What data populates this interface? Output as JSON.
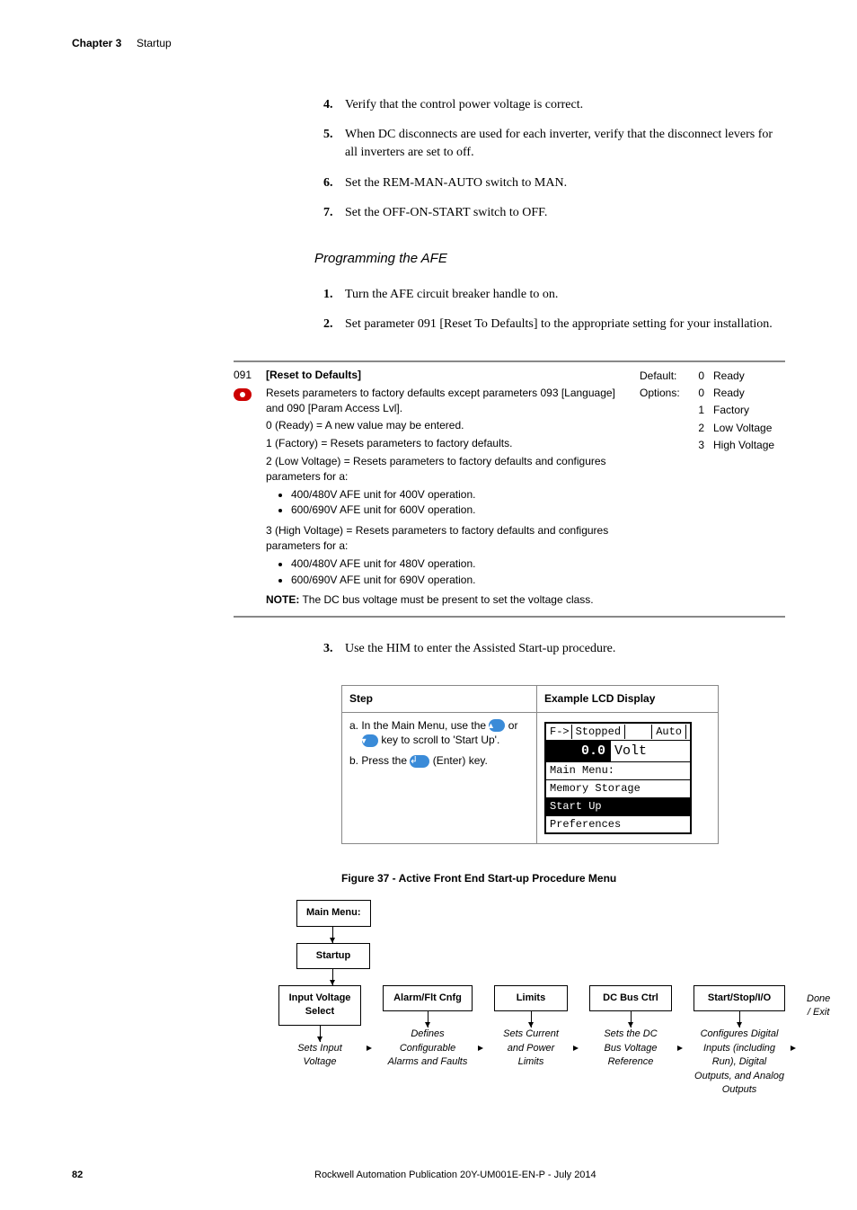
{
  "header": {
    "chapter": "Chapter 3",
    "title": "Startup"
  },
  "steps1": [
    {
      "n": "4.",
      "t": "Verify that the control power voltage is correct."
    },
    {
      "n": "5.",
      "t": "When DC disconnects are used for each inverter, verify that the disconnect levers for all inverters are set to off."
    },
    {
      "n": "6.",
      "t": "Set the REM-MAN-AUTO switch to MAN."
    },
    {
      "n": "7.",
      "t": "Set the OFF-ON-START switch to OFF."
    }
  ],
  "section2": "Programming the AFE",
  "steps2": [
    {
      "n": "1.",
      "t": "Turn the AFE circuit breaker handle to on."
    },
    {
      "n": "2.",
      "t": "Set parameter 091 [Reset To Defaults] to the appropriate setting for your installation."
    }
  ],
  "param": {
    "num": "091",
    "name": "[Reset to Defaults]",
    "desc": "Resets parameters to factory defaults except parameters 093 [Language] and 090 [Param Access Lvl].",
    "l0": "0 (Ready) = A new value may be entered.",
    "l1": "1 (Factory) = Resets parameters to factory defaults.",
    "l2": "2 (Low Voltage) = Resets parameters to factory defaults and configures parameters for a:",
    "b2a": "400/480V AFE unit for 400V operation.",
    "b2b": "600/690V AFE unit for 600V operation.",
    "l3": "3 (High Voltage) = Resets parameters to factory defaults and configures parameters for a:",
    "b3a": "400/480V AFE unit for 480V operation.",
    "b3b": "600/690V AFE unit for 690V operation.",
    "note_label": "NOTE:",
    "note": " The DC bus voltage must be present to set the voltage class.",
    "default_label": "Default:",
    "options_label": "Options:",
    "default_val": "0",
    "opts": [
      "0",
      "1",
      "2",
      "3"
    ],
    "default_name": "Ready",
    "opt_names": [
      "Ready",
      "Factory",
      "Low Voltage",
      "High Voltage"
    ]
  },
  "steps3": [
    {
      "n": "3.",
      "t": "Use the HIM to enter the Assisted Start-up procedure."
    }
  ],
  "step_table": {
    "h1": "Step",
    "h2": "Example LCD Display",
    "a_pre": "a.  In the Main Menu, use the ",
    "a_mid": " or ",
    "a_post": " key to scroll to 'Start Up'.",
    "b_pre": "b.  Press the ",
    "b_post": " (Enter) key."
  },
  "lcd": {
    "r1a": "F->",
    "r1b": "Stopped",
    "r1c": "Auto",
    "big_val": "0.0",
    "big_unit": "Volt",
    "r3": "Main Menu:",
    "r4": "Memory Storage",
    "r5": "Start Up",
    "r6": "Preferences"
  },
  "figure": "Figure 37 - Active Front End Start-up Procedure Menu",
  "flow": {
    "main": "Main Menu:",
    "startup": "Startup",
    "b1": "Input Voltage Select",
    "b2": "Alarm/Flt Cnfg",
    "b3": "Limits",
    "b4": "DC Bus Ctrl",
    "b5": "Start/Stop/I/O",
    "done": "Done / Exit",
    "d1": "Sets Input Voltage",
    "d2": "Defines Configurable Alarms and Faults",
    "d3": "Sets Current and Power Limits",
    "d4": "Sets the DC Bus Voltage Reference",
    "d5": "Configures Digital Inputs (including Run), Digital Outputs, and Analog Outputs"
  },
  "footer": {
    "page": "82",
    "pub": "Rockwell Automation Publication 20Y-UM001E-EN-P - July 2014"
  }
}
